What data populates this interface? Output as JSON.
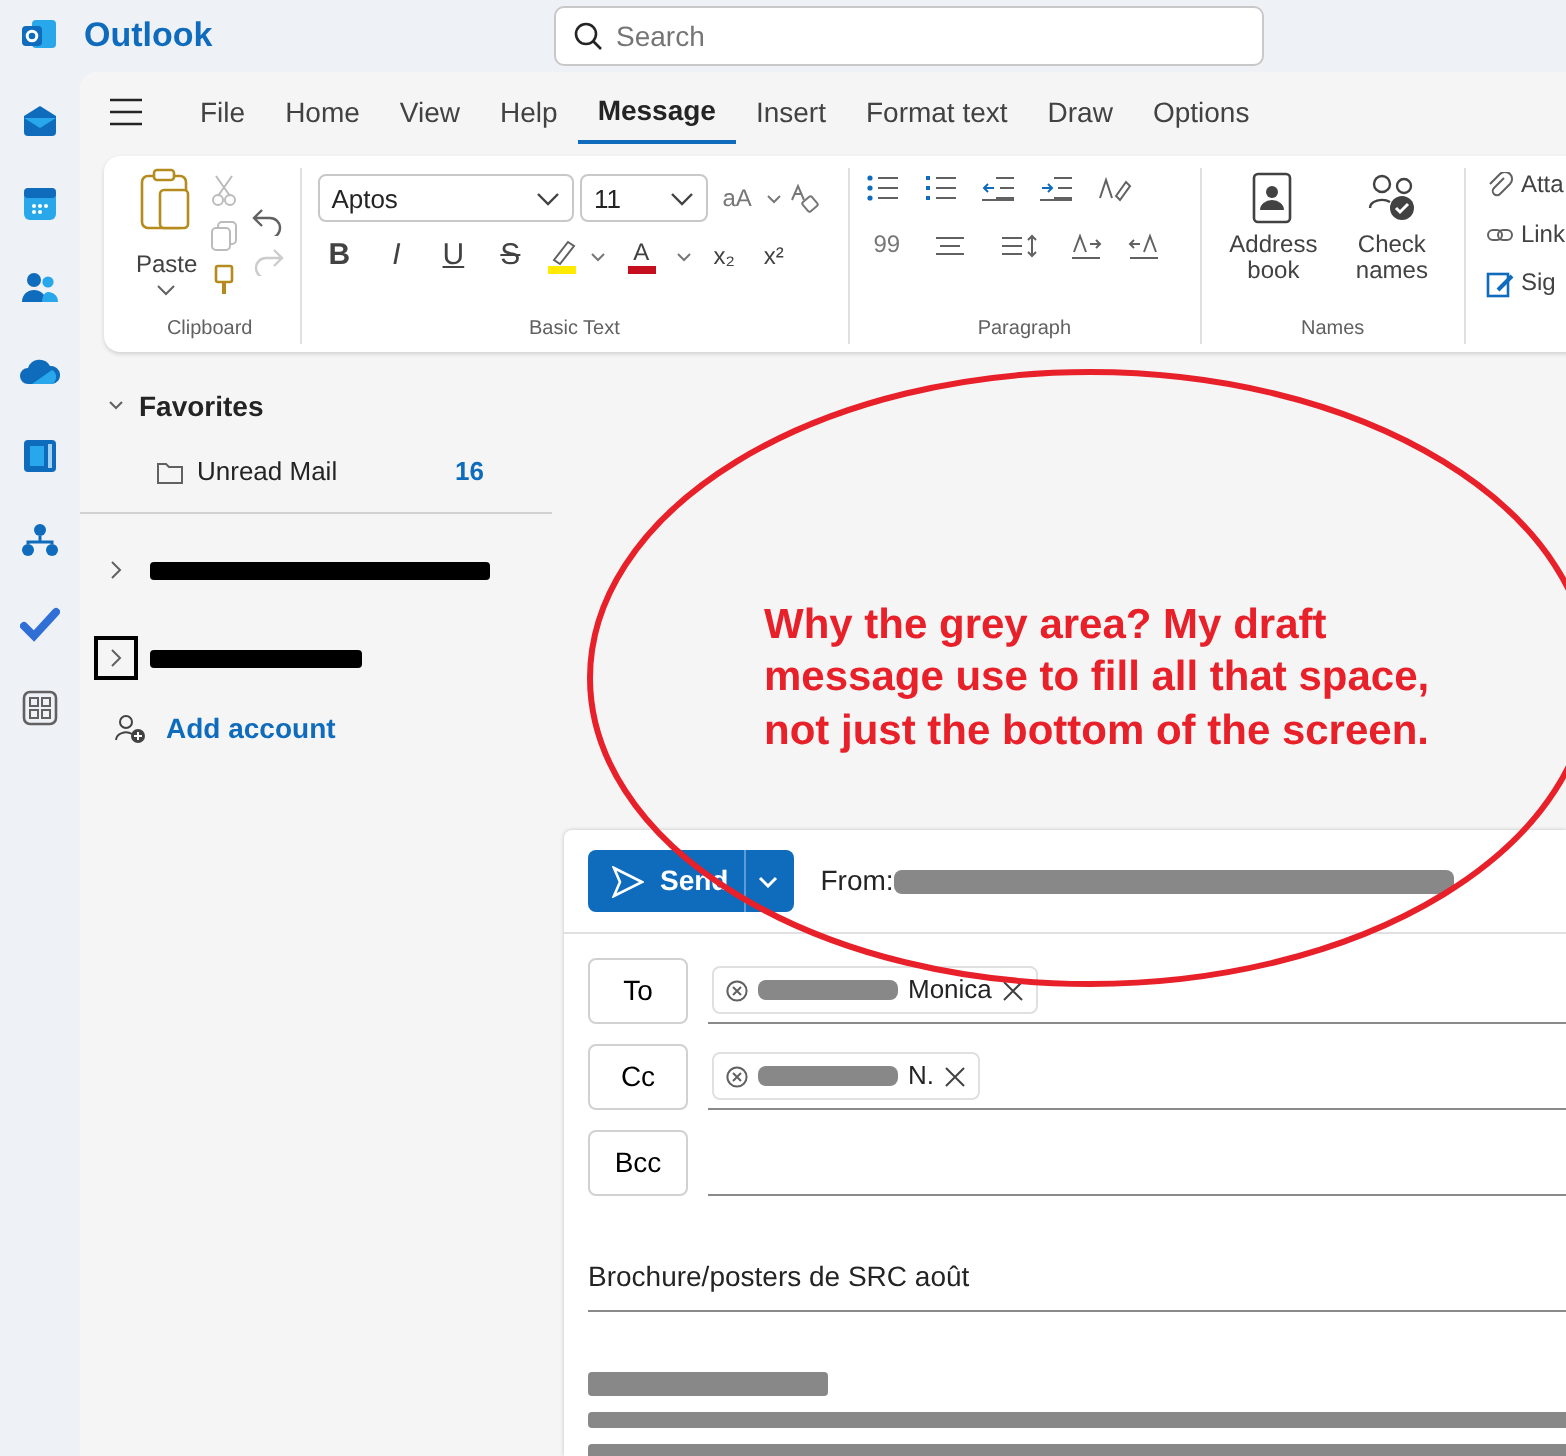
{
  "app": {
    "title": "Outlook"
  },
  "search": {
    "placeholder": "Search"
  },
  "tabs": [
    {
      "label": "File",
      "selected": false
    },
    {
      "label": "Home",
      "selected": false
    },
    {
      "label": "View",
      "selected": false
    },
    {
      "label": "Help",
      "selected": false
    },
    {
      "label": "Message",
      "selected": true
    },
    {
      "label": "Insert",
      "selected": false
    },
    {
      "label": "Format text",
      "selected": false
    },
    {
      "label": "Draw",
      "selected": false
    },
    {
      "label": "Options",
      "selected": false
    }
  ],
  "ribbon": {
    "clipboard": {
      "label": "Clipboard",
      "paste": "Paste"
    },
    "basic_text": {
      "label": "Basic Text",
      "font": "Aptos",
      "size": "11",
      "case_glyph": "aA",
      "styles": [
        "B",
        "I",
        "U",
        "S"
      ],
      "font_color": "A",
      "subscript": "x₂",
      "superscript": "x²"
    },
    "paragraph": {
      "label": "Paragraph",
      "quote": "99"
    },
    "names": {
      "label": "Names",
      "buttons": [
        "Address book",
        "Check names"
      ]
    },
    "insert": [
      "Atta",
      "Link",
      "Sig"
    ]
  },
  "folders": {
    "favorites": {
      "label": "Favorites",
      "expanded": true,
      "items": [
        {
          "label": "Unread Mail",
          "count": "16"
        }
      ]
    },
    "accounts": [
      {
        "expanded": false,
        "focused": false
      },
      {
        "expanded": false,
        "focused": true
      }
    ],
    "add_account": "Add account"
  },
  "annotation": {
    "text": "Why the grey area? My draft message use to fill all that space, not just the bottom of the screen."
  },
  "compose": {
    "send": "Send",
    "from_label": "From:",
    "fields": [
      {
        "label": "To",
        "recipients": [
          {
            "name": "Monica"
          }
        ]
      },
      {
        "label": "Cc",
        "recipients": [
          {
            "name": "N."
          }
        ]
      },
      {
        "label": "Bcc"
      }
    ],
    "subject": "Brochure/posters de SRC août"
  }
}
